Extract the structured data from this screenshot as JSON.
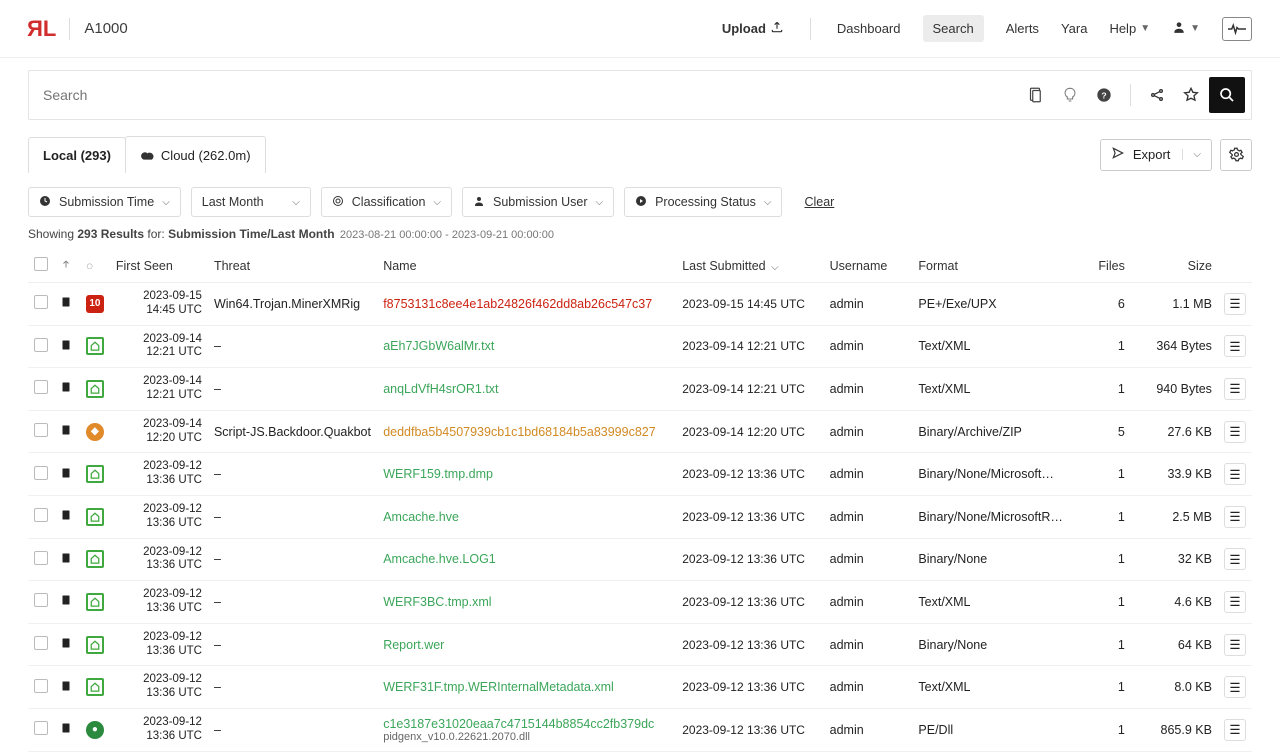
{
  "header": {
    "logo": "ЯL",
    "product": "A1000",
    "upload": "Upload",
    "nav": {
      "dashboard": "Dashboard",
      "search": "Search",
      "alerts": "Alerts",
      "yara": "Yara",
      "help": "Help"
    }
  },
  "search": {
    "placeholder": "Search"
  },
  "tabs": {
    "local": "Local (293)",
    "cloud": "Cloud (262.0m)"
  },
  "export_label": "Export",
  "filters": {
    "submission_time": "Submission Time",
    "last_month": "Last Month",
    "classification": "Classification",
    "submission_user": "Submission User",
    "processing_status": "Processing Status",
    "clear": "Clear"
  },
  "summary": {
    "prefix": "Showing ",
    "count": "293 Results",
    "for": " for: ",
    "criteria": "Submission Time/Last Month",
    "daterange": "2023-08-21 00:00:00 - 2023-09-21 00:00:00"
  },
  "columns": {
    "first_seen": "First Seen",
    "threat": "Threat",
    "name": "Name",
    "last_submitted": "Last Submitted",
    "username": "Username",
    "format": "Format",
    "files": "Files",
    "size": "Size"
  },
  "rows": [
    {
      "sev": "red10",
      "date": "2023-09-15",
      "time": "14:45 UTC",
      "threat": "Win64.Trojan.MinerXMRig",
      "name": "f8753131c8ee4e1ab24826f462dd8ab26c547c37",
      "name_style": "malicious",
      "last": "2023-09-15 14:45 UTC",
      "user": "admin",
      "format": "PE+/Exe/UPX",
      "files": "6",
      "size": "1.1 MB"
    },
    {
      "sev": "greenhome",
      "date": "2023-09-14",
      "time": "12:21 UTC",
      "threat": "–",
      "name": "aEh7JGbW6alMr.txt",
      "name_style": "good",
      "last": "2023-09-14 12:21 UTC",
      "user": "admin",
      "format": "Text/XML",
      "files": "1",
      "size": "364 Bytes"
    },
    {
      "sev": "greenhome",
      "date": "2023-09-14",
      "time": "12:21 UTC",
      "threat": "–",
      "name": "anqLdVfH4srOR1.txt",
      "name_style": "good",
      "last": "2023-09-14 12:21 UTC",
      "user": "admin",
      "format": "Text/XML",
      "files": "1",
      "size": "940 Bytes"
    },
    {
      "sev": "orange",
      "date": "2023-09-14",
      "time": "12:20 UTC",
      "threat": "Script-JS.Backdoor.Quakbot",
      "name": "deddfba5b4507939cb1c1bd68184b5a83999c827",
      "name_style": "suspicious",
      "last": "2023-09-14 12:20 UTC",
      "user": "admin",
      "format": "Binary/Archive/ZIP",
      "files": "5",
      "size": "27.6 KB"
    },
    {
      "sev": "greenhome",
      "date": "2023-09-12",
      "time": "13:36 UTC",
      "threat": "–",
      "name": "WERF159.tmp.dmp",
      "name_style": "good",
      "last": "2023-09-12 13:36 UTC",
      "user": "admin",
      "format": "Binary/None/Microsoft…",
      "files": "1",
      "size": "33.9 KB"
    },
    {
      "sev": "greenhome",
      "date": "2023-09-12",
      "time": "13:36 UTC",
      "threat": "–",
      "name": "Amcache.hve",
      "name_style": "good",
      "last": "2023-09-12 13:36 UTC",
      "user": "admin",
      "format": "Binary/None/MicrosoftR…",
      "files": "1",
      "size": "2.5 MB"
    },
    {
      "sev": "greenhome",
      "date": "2023-09-12",
      "time": "13:36 UTC",
      "threat": "–",
      "name": "Amcache.hve.LOG1",
      "name_style": "good",
      "last": "2023-09-12 13:36 UTC",
      "user": "admin",
      "format": "Binary/None",
      "files": "1",
      "size": "32 KB"
    },
    {
      "sev": "greenhome",
      "date": "2023-09-12",
      "time": "13:36 UTC",
      "threat": "–",
      "name": "WERF3BC.tmp.xml",
      "name_style": "good",
      "last": "2023-09-12 13:36 UTC",
      "user": "admin",
      "format": "Text/XML",
      "files": "1",
      "size": "4.6 KB"
    },
    {
      "sev": "greenhome",
      "date": "2023-09-12",
      "time": "13:36 UTC",
      "threat": "–",
      "name": "Report.wer",
      "name_style": "good",
      "last": "2023-09-12 13:36 UTC",
      "user": "admin",
      "format": "Binary/None",
      "files": "1",
      "size": "64 KB"
    },
    {
      "sev": "greenhome",
      "date": "2023-09-12",
      "time": "13:36 UTC",
      "threat": "–",
      "name": "WERF31F.tmp.WERInternalMetadata.xml",
      "name_style": "good",
      "last": "2023-09-12 13:36 UTC",
      "user": "admin",
      "format": "Text/XML",
      "files": "1",
      "size": "8.0 KB"
    },
    {
      "sev": "greendot",
      "date": "2023-09-12",
      "time": "13:36 UTC",
      "threat": "–",
      "name": "c1e3187e31020eaa7c4715144b8854cc2fb379dc",
      "sub_name": "pidgenx_v10.0.22621.2070.dll",
      "name_style": "good",
      "last": "2023-09-12 13:36 UTC",
      "user": "admin",
      "format": "PE/Dll",
      "files": "1",
      "size": "865.9 KB"
    }
  ]
}
